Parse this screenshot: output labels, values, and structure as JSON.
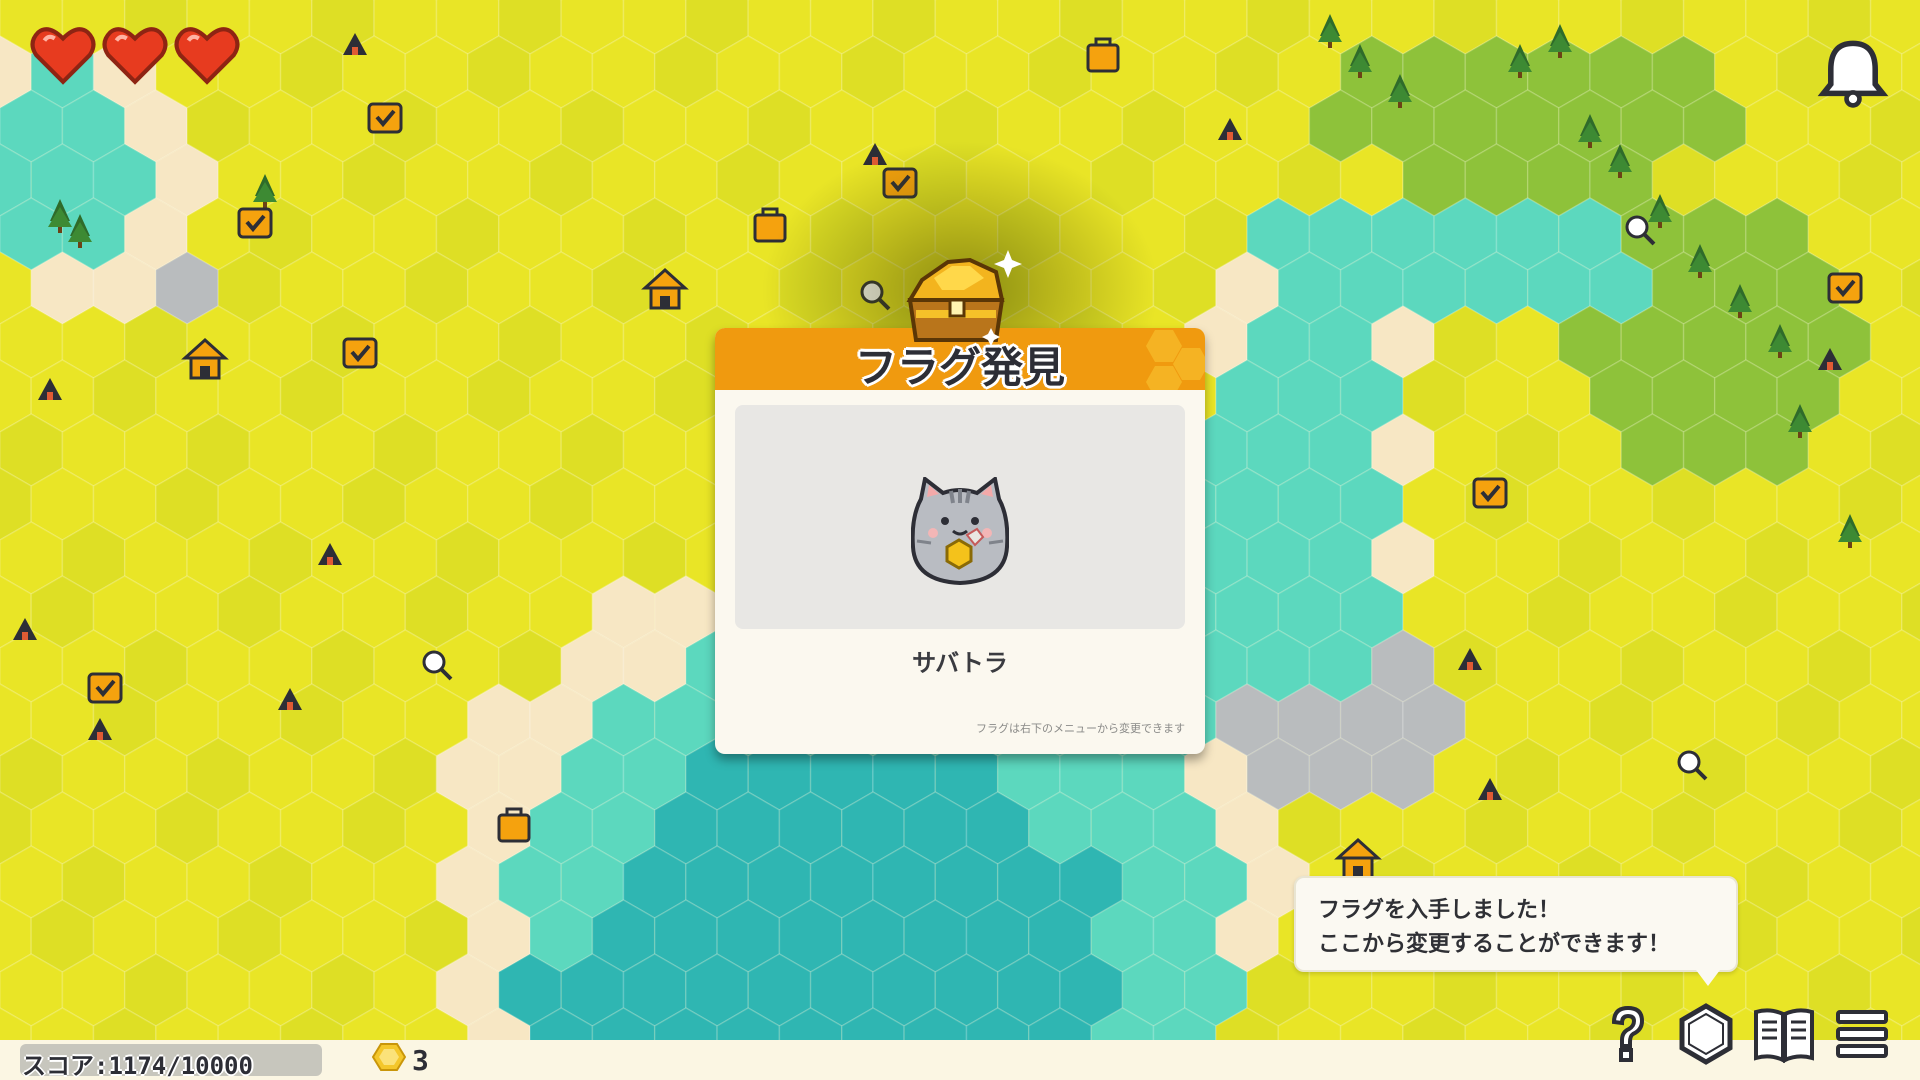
{
  "hud": {
    "hearts": 3,
    "score_label": "スコア:1174/10000",
    "flag_count": "3"
  },
  "popup": {
    "title": "フラグ発見",
    "flag_name": "サバトラ",
    "note": "フラグは右下のメニューから変更できます"
  },
  "tooltip": {
    "line1": "フラグを入手しました！",
    "line2": "ここから変更することができます！"
  },
  "menu": {
    "buttons": [
      "help-icon",
      "hex-flag-icon",
      "book-icon",
      "menu-icon"
    ]
  },
  "colors": {
    "land": "#e9e526",
    "land_dark": "#dedf25",
    "shallow_water": "#5cd8be",
    "deep_water": "#2fb6b2",
    "sand": "#f7e7c4",
    "popup_header": "#f09a0f",
    "heart": "#e73b1f",
    "icon_orange": "#f5a20e"
  }
}
